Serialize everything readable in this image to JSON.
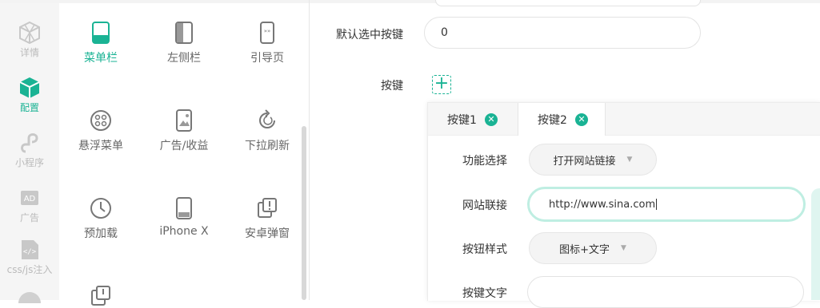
{
  "accent": "#1ab394",
  "left_nav": {
    "items": [
      {
        "label": "详情",
        "icon": "cube-outline-icon",
        "active": false
      },
      {
        "label": "配置",
        "icon": "cube-icon",
        "active": true
      },
      {
        "label": "小程序",
        "icon": "miniprogram-icon",
        "active": false
      },
      {
        "label": "广告",
        "icon": "ad-icon",
        "active": false
      },
      {
        "label": "css/js注入",
        "icon": "code-file-icon",
        "active": false
      }
    ]
  },
  "features": [
    {
      "label": "菜单栏",
      "icon": "phone-menubar-icon",
      "active": true
    },
    {
      "label": "左侧栏",
      "icon": "phone-sidebar-icon",
      "active": false
    },
    {
      "label": "引导页",
      "icon": "phone-guide-icon",
      "active": false
    },
    {
      "label": "悬浮菜单",
      "icon": "float-menu-icon",
      "active": false
    },
    {
      "label": "广告/收益",
      "icon": "phone-ad-icon",
      "active": false
    },
    {
      "label": "下拉刷新",
      "icon": "refresh-icon",
      "active": false
    },
    {
      "label": "预加载",
      "icon": "clock-icon",
      "active": false
    },
    {
      "label": "iPhone X",
      "icon": "iphonex-icon",
      "active": false
    },
    {
      "label": "安卓弹窗",
      "icon": "android-popup-icon",
      "active": false
    }
  ],
  "form": {
    "default_key_label": "默认选中按键",
    "default_key_value": "0",
    "buttons_label": "按键",
    "plus_symbol": "+"
  },
  "button_panel": {
    "tabs": [
      {
        "label": "按键1",
        "close": "✕",
        "active": false
      },
      {
        "label": "按键2",
        "close": "✕",
        "active": true
      }
    ],
    "function_label": "功能选择",
    "function_value": "打开网站链接",
    "url_label": "网站联接",
    "url_value": "http://www.sina.com",
    "style_label": "按钮样式",
    "style_value": "图标+文字",
    "text_label": "按键文字",
    "dropdown_arrow": "▼"
  }
}
